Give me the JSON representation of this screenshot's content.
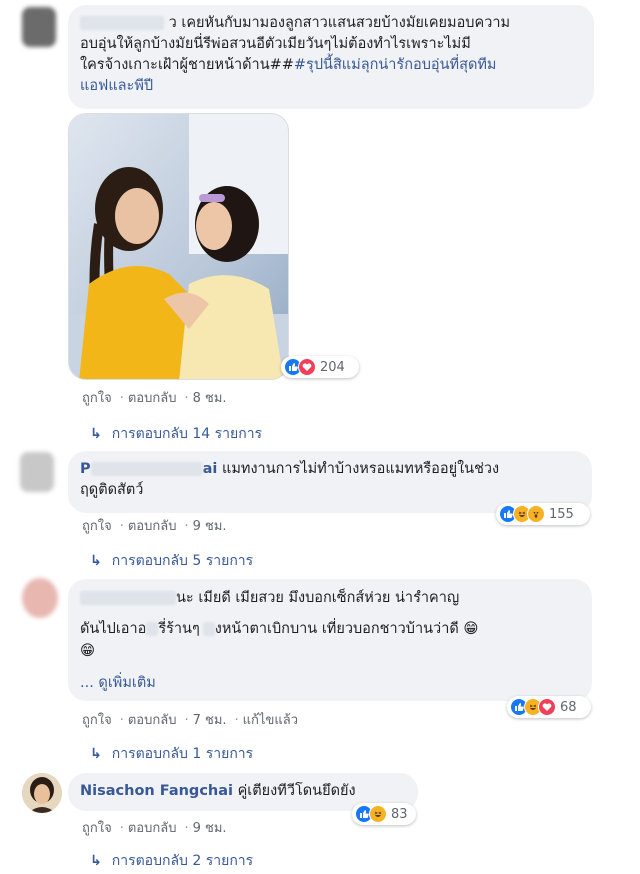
{
  "comments": [
    {
      "text_lines": [
        "ว เคยหันกับมามองลูกสาวแสนสวยบ้างมัยเคยมอบความ",
        "อบอุ่นให้ลูกบ้างมัยนี่รีพ่อสวนอีตัวเมียวันๆไม่ต้องทำไรเพราะไม่มี",
        "ใครจ้างเกาะเฝ้าผู้ชายหน้าด้าน##"
      ],
      "link_text": "#รุปนี้สิแม่ลุกน่ารักอบอุ่นที่สุดทีม",
      "link_text_2": "แอฟและพีปี",
      "reactions_count": "204",
      "actions": {
        "like": "ถูกใจ",
        "reply": "ตอบกลับ",
        "time": "8 ชม."
      },
      "replies_label": "การตอบกลับ 14 รายการ"
    },
    {
      "name_start": "P",
      "name_end": "ai",
      "text_line1": "แมทงานการไม่ทำบ้างหรอแมทหรืออยู่ในช่วง",
      "text_line2": "ฤดูติดสัตว์",
      "reactions_count": "155",
      "actions": {
        "like": "ถูกใจ",
        "reply": "ตอบกลับ",
        "time": "9 ชม."
      },
      "replies_label": "การตอบกลับ 5 รายการ"
    },
    {
      "text_line1_part1": "น",
      "text_line1_part2": "ะ เมียดี เมียสวย มึงบอกเซ็กส์ห่วย น่ารำคาญ",
      "text_line2_part1": "ดันไปเอาอ",
      "text_line2_part2": "รี่ร้านๆ",
      "text_line2_part3": "งหน้าตาเบิกบาน เที่ยวบอกชาวบ้านว่าดี 😁",
      "text_line3": "😁",
      "see_more": "... ดูเพิ่มเติม",
      "reactions_count": "68",
      "actions": {
        "like": "ถูกใจ",
        "reply": "ตอบกลับ",
        "time": "7 ชม.",
        "edited": "แก้ไขแล้ว"
      },
      "replies_label": "การตอบกลับ 1 รายการ"
    },
    {
      "name": "Nisachon Fangchai",
      "text": "คู่เตียงทีวีโดนยึดยัง",
      "reactions_count": "83",
      "actions": {
        "like": "ถูกใจ",
        "reply": "ตอบกลับ",
        "time": "9 ชม."
      },
      "replies_label": "การตอบกลับ 2 รายการ"
    }
  ],
  "colors": {
    "link": "#385898",
    "bubble": "#f0f2f5",
    "like": "#1877f2",
    "love": "#f33e58",
    "haha": "#f7b125"
  },
  "icons": [
    "like-icon",
    "love-icon",
    "haha-icon",
    "reply-arrow-icon"
  ]
}
